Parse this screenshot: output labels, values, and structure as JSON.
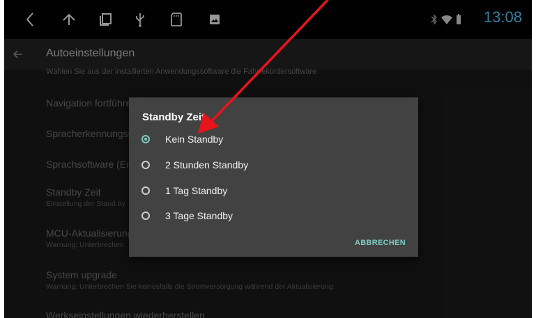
{
  "status_bar": {
    "clock": "13:08",
    "nav_icons": [
      "back-icon",
      "home-icon",
      "recent-apps-icon",
      "usb-icon",
      "sd-card-icon",
      "gallery-icon"
    ],
    "status_icons": [
      "bluetooth-icon",
      "wifi-icon",
      "battery-icon"
    ]
  },
  "header": {
    "title": "Autoeinstellungen",
    "description": "Wählen Sie aus der installierten Anwendungssoftware die Fahrrekordersoftware"
  },
  "settings": [
    {
      "title": "Navigation fortführe",
      "subtitle": ""
    },
    {
      "title": "Spracherkennungss",
      "subtitle": ""
    },
    {
      "title": "Sprachsoftware (En",
      "subtitle": ""
    },
    {
      "title": "Standby Zeit",
      "subtitle": "Einstellung der Stand by"
    },
    {
      "title": "MCU-Aktualisierung",
      "subtitle": "Warnung: Unterbrechen"
    },
    {
      "title": "System upgrade",
      "subtitle": "Warnung: Unterbrechen Sie keinesfalls die Stromversorgung während der Aktualisierung."
    },
    {
      "title": "Werkseinstellungen wiederherstellen",
      "subtitle": ""
    }
  ],
  "dialog": {
    "title": "Standby Zeit",
    "options": [
      {
        "label": "Kein Standby",
        "selected": true
      },
      {
        "label": "2 Stunden Standby",
        "selected": false
      },
      {
        "label": "1 Tag Standby",
        "selected": false
      },
      {
        "label": "3 Tage Standby",
        "selected": false
      }
    ],
    "cancel_label": "ABBRECHEN"
  },
  "colors": {
    "accent": "#80cbc4",
    "clock": "#4fc3f7",
    "annotation_arrow": "#e8141b"
  }
}
